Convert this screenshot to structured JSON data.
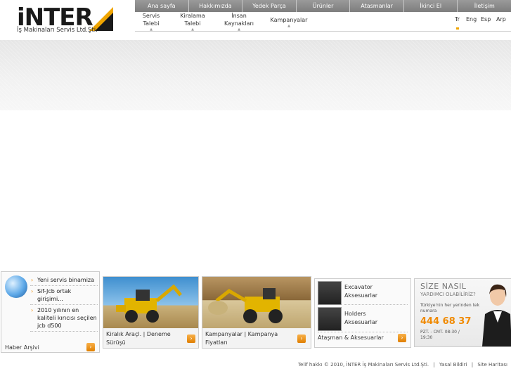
{
  "brand": {
    "logo_text": "iNTER",
    "company": "İş Makinaları Servis Ltd.Şti."
  },
  "topnav": [
    "Ana sayfa",
    "Hakkımızda",
    "Yedek Parça",
    "Ürünler",
    "Atasmanlar",
    "İkinci El",
    "İletişim"
  ],
  "subnav": {
    "items": [
      "Servis Talebi",
      "Kiralama Talebi",
      "İnsan Kaynakları",
      "Kampanyalar"
    ],
    "languages": [
      "Tr",
      "Eng",
      "Esp",
      "Arp"
    ]
  },
  "news": {
    "items": [
      "Yeni servis binamiza",
      "Sif-Jcb ortak girişimi...",
      "2010 yılının en kaliteli kırıcısı seçilen jcb d500"
    ],
    "footer": "Haber Arşivi"
  },
  "cards": [
    {
      "caption": "Kiralık Araçl. | Deneme Sürüşü"
    },
    {
      "caption": "Kampanyalar | Kampanya Fiyatları"
    }
  ],
  "accessories": {
    "items": [
      "Excavator Aksesuarlar",
      "Holders Aksesuarlar"
    ],
    "footer": "Ataşman & Aksesuarlar"
  },
  "help": {
    "title": "SİZE NASIL",
    "subtitle": "YARDIMCI OLABİLİRİZ?",
    "text": "Türkiye'nin her yerinden tek numara",
    "phone": "444 68 37",
    "hours": "PZT. - CMT. 08:30 / 19:30"
  },
  "footer": {
    "copyright": "Telif hakkı © 2010, İNTER İş Makinaları Servis Ltd.Şti.",
    "links": [
      "Yasal Bildiri",
      "Site Haritası"
    ]
  },
  "colors": {
    "accent": "#f08a00",
    "nav": "#8a8a8a"
  }
}
